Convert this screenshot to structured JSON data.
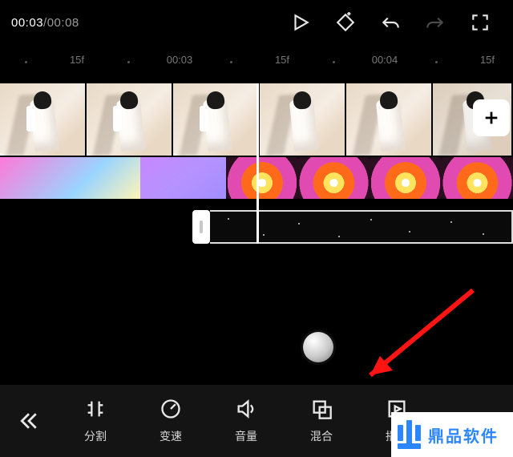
{
  "timecode": {
    "current": "00:03",
    "total": "00:08",
    "sep": "/"
  },
  "ruler": [
    "·",
    "15f",
    "·",
    "00:03",
    "·",
    "15f",
    "·",
    "00:04",
    "·",
    "15f"
  ],
  "add_label": "+",
  "toolbar": {
    "back": "«",
    "items": [
      {
        "key": "split",
        "label": "分割"
      },
      {
        "key": "speed",
        "label": "变速"
      },
      {
        "key": "volume",
        "label": "音量"
      },
      {
        "key": "blend",
        "label": "混合"
      },
      {
        "key": "preview",
        "label": "播放"
      }
    ]
  },
  "watermark": {
    "text": "鼎品软件"
  }
}
